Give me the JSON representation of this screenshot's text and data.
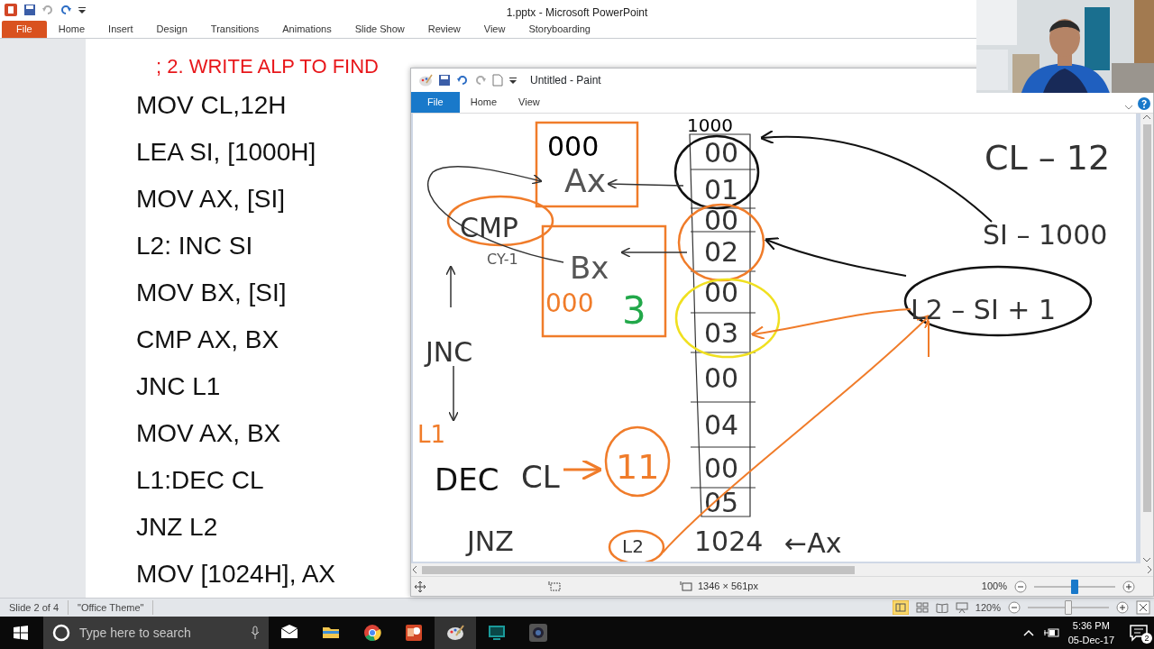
{
  "powerpoint": {
    "title": "1.pptx - Microsoft PowerPoint",
    "tabs": [
      {
        "label": "File",
        "kind": "file"
      },
      {
        "label": "Home",
        "kind": "tab"
      },
      {
        "label": "Insert",
        "kind": "tab"
      },
      {
        "label": "Design",
        "kind": "tab"
      },
      {
        "label": "Transitions",
        "kind": "tab"
      },
      {
        "label": "Animations",
        "kind": "tab"
      },
      {
        "label": "Slide Show",
        "kind": "tab"
      },
      {
        "label": "Review",
        "kind": "tab"
      },
      {
        "label": "View",
        "kind": "tab"
      },
      {
        "label": "Storyboarding",
        "kind": "tab"
      }
    ],
    "slide": {
      "title": "; 2. WRITE ALP TO FIND",
      "lines": [
        "MOV CL,12H",
        "LEA SI, [1000H]",
        "MOV AX, [SI]",
        "L2: INC SI",
        "MOV BX, [SI]",
        "CMP AX, BX",
        "JNC L1",
        "MOV AX, BX",
        "L1:DEC CL",
        "JNZ L2",
        "MOV [1024H], AX"
      ]
    },
    "status_bar": {
      "slide": "Slide 2 of 4",
      "theme": "\"Office Theme\"",
      "zoom": {
        "reading": "120%",
        "level": 0.5
      }
    }
  },
  "paint": {
    "title": "Untitled - Paint",
    "tabs": [
      {
        "label": "File",
        "kind": "file"
      },
      {
        "label": "Home",
        "kind": "tab"
      },
      {
        "label": "View",
        "kind": "tab"
      }
    ],
    "canvas": {
      "memory": [
        "00",
        "01",
        "00",
        "02",
        "00",
        "03",
        "00",
        "04",
        "00",
        "05"
      ],
      "notes": [
        {
          "text": "1000",
          "color": "#000000"
        },
        {
          "text": "000",
          "color": "#000000"
        },
        {
          "text": "Ax",
          "color": "#555555"
        },
        {
          "text": "CMP",
          "color": "#333333"
        },
        {
          "text": "CY-1",
          "color": "#555555"
        },
        {
          "text": "Bx",
          "color": "#555555"
        },
        {
          "text": "000",
          "color": "#f07c2a"
        },
        {
          "text": "3",
          "color": "#22a84a"
        },
        {
          "text": "JNC",
          "color": "#333333"
        },
        {
          "text": "L1",
          "color": "#f07c2a"
        },
        {
          "text": "DEC",
          "color": "#111111"
        },
        {
          "text": "CL",
          "color": "#333333"
        },
        {
          "text": "11",
          "color": "#f07c2a"
        },
        {
          "text": "JNZ",
          "color": "#333333"
        },
        {
          "text": "L2",
          "color": "#333333"
        },
        {
          "text": "1024",
          "color": "#333333"
        },
        {
          "text": "←Ax",
          "color": "#333333"
        },
        {
          "text": "CL – 12",
          "color": "#333333"
        },
        {
          "text": "SI – 1000",
          "color": "#333333"
        },
        {
          "text": "L2 – SI + 1",
          "color": "#333333"
        }
      ]
    },
    "status_bar": {
      "size": "1346 × 561px",
      "zoom": {
        "reading": "100%",
        "level": 0.5
      }
    }
  },
  "taskbar": {
    "search": {
      "placeholder": "Type here to search"
    },
    "time": "5:36 PM",
    "date": "05-Dec-17",
    "notifications": "2"
  }
}
